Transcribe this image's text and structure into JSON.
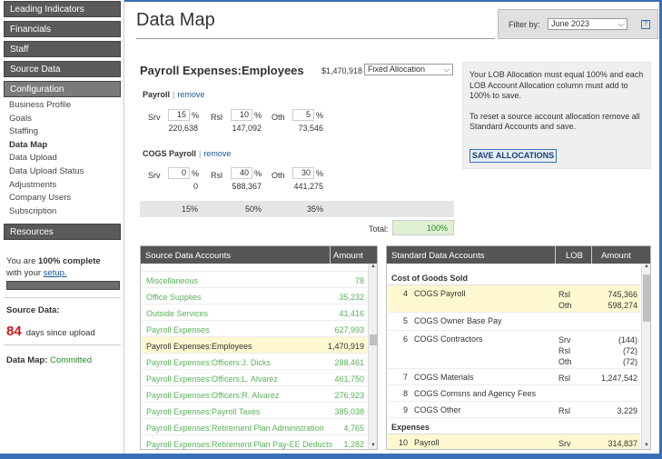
{
  "sidebar": {
    "nav": [
      {
        "label": "Leading Indicators"
      },
      {
        "label": "Financials"
      },
      {
        "label": "Staff"
      },
      {
        "label": "Source Data"
      },
      {
        "label": "Configuration"
      }
    ],
    "config_items": [
      "Business Profile",
      "Goals",
      "Staffing",
      "Data Map",
      "Data Upload",
      "Data Upload Status",
      "Adjustments",
      "Company Users",
      "Subscription"
    ],
    "resources_label": "Resources",
    "complete_prefix": "You are ",
    "complete_pct": "100% complete",
    "complete_mid": "with your ",
    "setup_link": "setup.",
    "setup_progress": 1.0,
    "source_data_label": "Source Data:",
    "days_count": "84",
    "days_text": "days since upload",
    "data_map_label": "Data Map:",
    "data_map_status": "Committed"
  },
  "header": {
    "title": "Data Map",
    "filter_label": "Filter by:",
    "filter_value": "June 2023",
    "help": "?"
  },
  "allocation": {
    "title": "Payroll Expenses:Employees",
    "amount": "$1,470,918",
    "method": "Fixed Allocation",
    "sections": [
      {
        "name": "Payroll",
        "remove": "remove",
        "lobs": [
          {
            "lob": "Srv",
            "pct": "15",
            "amount": "220,638"
          },
          {
            "lob": "Rsl",
            "pct": "10",
            "amount": "147,092"
          },
          {
            "lob": "Oth",
            "pct": "5",
            "amount": "73,546"
          }
        ]
      },
      {
        "name": "COGS Payroll",
        "remove": "remove",
        "lobs": [
          {
            "lob": "Srv",
            "pct": "0",
            "amount": "0"
          },
          {
            "lob": "Rsl",
            "pct": "40",
            "amount": "588,367"
          },
          {
            "lob": "Oth",
            "pct": "30",
            "amount": "441,275"
          }
        ]
      }
    ],
    "pct_sign": "%",
    "totals": [
      "15%",
      "50%",
      "35%"
    ],
    "total_label": "Total:",
    "total_value": "100%"
  },
  "info": {
    "line1": "Your LOB Allocation must equal 100% and each LOB Account Allocation column must add to 100% to save.",
    "line2": "To reset a source account allocation remove all Standard Accounts and save.",
    "save_label": "SAVE ALLOCATIONS"
  },
  "source_table": {
    "col_name": "Source Data Accounts",
    "col_amount": "Amount",
    "rows": [
      {
        "name": "Miscellaneous",
        "amount": "78"
      },
      {
        "name": "Office Supplies",
        "amount": "35,232"
      },
      {
        "name": "Outside Services",
        "amount": "41,416"
      },
      {
        "name": "Payroll Expenses",
        "amount": "627,993"
      },
      {
        "name": "Payroll Expenses:Employees",
        "amount": "1,470,919",
        "selected": true
      },
      {
        "name": "Payroll Expenses:Officers:J. Dicks",
        "amount": "288,461"
      },
      {
        "name": "Payroll Expenses:Officers:L. Alvarez",
        "amount": "461,750"
      },
      {
        "name": "Payroll Expenses:Officers:R. Alvarez",
        "amount": "276,923"
      },
      {
        "name": "Payroll Expenses:Payroll Taxes",
        "amount": "385,038"
      },
      {
        "name": "Payroll Expenses:Retirement Plan Administration",
        "amount": "4,765"
      },
      {
        "name": "Payroll Expenses:Retirement Plan Pay-EE Deducts",
        "amount": "1,282"
      }
    ]
  },
  "standard_table": {
    "col_name": "Standard Data Accounts",
    "col_lob": "LOB",
    "col_amount": "Amount",
    "group_cogs": "Cost of Goods Sold",
    "group_expenses": "Expenses",
    "rows": [
      {
        "no": "4",
        "name": "COGS Payroll",
        "lobs": [
          "Rsl",
          "Oth"
        ],
        "amounts": [
          "745,366",
          "598,274"
        ],
        "selected": true
      },
      {
        "no": "5",
        "name": "COGS Owner Base Pay",
        "lobs": [],
        "amounts": []
      },
      {
        "no": "6",
        "name": "COGS Contractors",
        "lobs": [
          "Srv",
          "Rsl",
          "Oth"
        ],
        "amounts": [
          "(144)",
          "(72)",
          "(72)"
        ]
      },
      {
        "no": "7",
        "name": "COGS Materials",
        "lobs": [
          "Rsl"
        ],
        "amounts": [
          "1,247,542"
        ]
      },
      {
        "no": "8",
        "name": "COGS Comsns and Agency Fees",
        "lobs": [],
        "amounts": []
      },
      {
        "no": "9",
        "name": "COGS Other",
        "lobs": [
          "Rsl"
        ],
        "amounts": [
          "3,229"
        ]
      },
      {
        "no": "10",
        "name": "Payroll",
        "lobs": [
          "Srv"
        ],
        "amounts": [
          "314,837"
        ],
        "selected": true
      }
    ]
  }
}
